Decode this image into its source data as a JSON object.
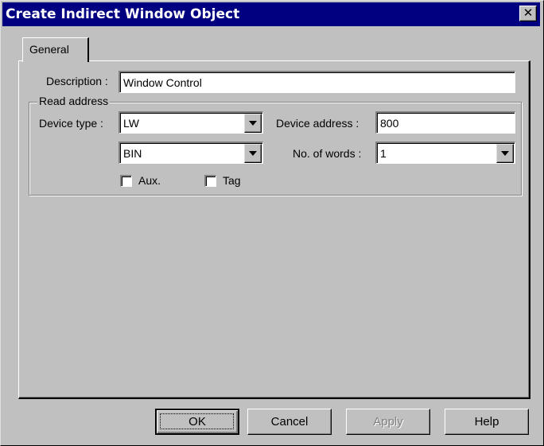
{
  "window": {
    "title": "Create Indirect Window  Object"
  },
  "tabs": [
    {
      "label": "General"
    }
  ],
  "form": {
    "description_label": "Description :",
    "description_value": "Window Control",
    "group_title": "Read address",
    "device_type_label": "Device type :",
    "device_type_value": "LW",
    "format_value": "BIN",
    "device_address_label": "Device address :",
    "device_address_value": "800",
    "num_words_label": "No. of words :",
    "num_words_value": "1",
    "aux_label": "Aux.",
    "aux_checked": false,
    "tag_label": "Tag",
    "tag_checked": false
  },
  "buttons": {
    "ok": "OK",
    "cancel": "Cancel",
    "apply": "Apply",
    "help": "Help"
  },
  "icons": {
    "close": "close-icon",
    "dropdown": "chevron-down-icon"
  },
  "colors": {
    "titlebar": "#000080",
    "face": "#c0c0c0"
  }
}
